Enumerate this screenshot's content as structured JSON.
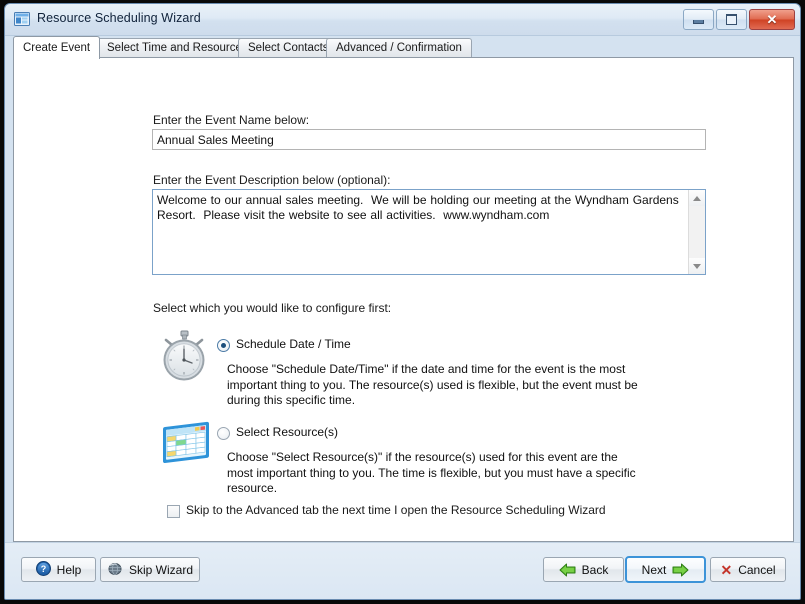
{
  "window": {
    "title": "Resource Scheduling Wizard",
    "icon": "window-app-icon",
    "controls": {
      "minimize": "minimize-icon",
      "maximize": "maximize-icon",
      "close": "✕"
    }
  },
  "tabs": [
    {
      "label": "Create Event",
      "active": true
    },
    {
      "label": "Select Time and Resources",
      "active": false
    },
    {
      "label": "Select Contacts",
      "active": false
    },
    {
      "label": "Advanced / Confirmation",
      "active": false
    }
  ],
  "form": {
    "event_name_label": "Enter the Event Name below:",
    "event_name_value": "Annual Sales Meeting",
    "event_name_placeholder": "",
    "event_description_label": "Enter the Event Description below (optional):",
    "event_description_value": "Welcome to our annual sales meeting.  We will be holding our meeting at the Wyndham Gardens Resort.  Please visit the website to see all activities.  www.wyndham.com",
    "event_description_placeholder": "",
    "configure_prompt": "Select which you would like to configure first:",
    "options": [
      {
        "id": "schedule-date-time",
        "label": "Schedule Date / Time",
        "selected": true,
        "icon": "stopwatch-icon",
        "description": "Choose \"Schedule Date/Time\" if the date and time for the event is the most important thing to you.  The resource(s) used is flexible, but the event must be during this specific time."
      },
      {
        "id": "select-resources",
        "label": "Select Resource(s)",
        "selected": false,
        "icon": "schedule-grid-icon",
        "description": "Choose \"Select Resource(s)\" if the resource(s) used for this event are the most important thing to you.  The time is flexible, but you must have a specific resource."
      }
    ],
    "skip_checkbox_label": "Skip to the Advanced tab the next time I open the Resource Scheduling Wizard",
    "skip_checkbox_checked": false
  },
  "footer": {
    "help_label": "Help",
    "help_icon": "question-circle-icon",
    "skip_wizard_label": "Skip Wizard",
    "skip_wizard_icon": "globe-icon",
    "back_label": "Back",
    "back_icon": "arrow-left-green-icon",
    "next_label": "Next",
    "next_icon": "arrow-right-green-icon",
    "next_focused": true,
    "cancel_label": "Cancel",
    "cancel_icon": "red-x-icon"
  },
  "colors": {
    "titlebar": "#dfeaf5",
    "window_bg": "#d4e2f0",
    "content_bg": "#ffffff",
    "accent_focus": "#3c93d8",
    "close_red": "#cf4224",
    "green_arrow": "#4caf28",
    "cancel_red": "#c4342a"
  }
}
